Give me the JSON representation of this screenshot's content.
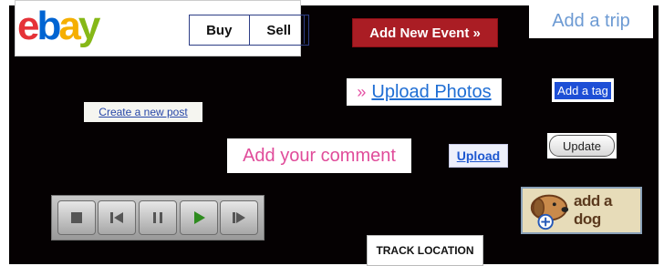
{
  "ebay": {
    "logo": {
      "e": "e",
      "b": "b",
      "a": "a",
      "y": "y"
    },
    "tabs": [
      "Buy",
      "Sell"
    ]
  },
  "buttons": {
    "add_event": "Add New Event »",
    "add_trip": "Add a trip",
    "upload_photos_arrow": "»",
    "upload_photos": "Upload Photos",
    "add_tag": "Add a tag",
    "create_post": "Create a new post",
    "add_comment": "Add your comment",
    "upload": "Upload",
    "update": "Update",
    "add_dog": "add a dog",
    "track_location": "TRACK LOCATION"
  },
  "player": {
    "icons": [
      "stop-icon",
      "previous-icon",
      "pause-icon",
      "play-icon",
      "next-icon"
    ]
  },
  "colors": {
    "background": "#050102",
    "event_red": "#aa1d24",
    "link_blue": "#1f6ed4",
    "comment_pink": "#e04c9a",
    "play_green": "#2e8b1f"
  }
}
